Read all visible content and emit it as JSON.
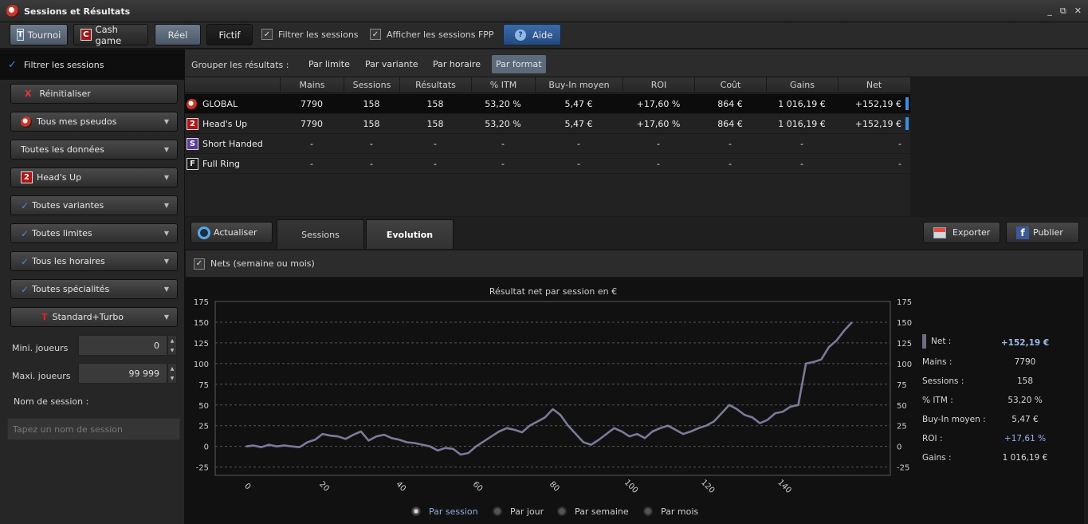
{
  "window": {
    "title": "Sessions et Résultats",
    "controls": [
      "_",
      "⧉",
      "✕"
    ]
  },
  "topbar": {
    "tournoi": {
      "badge": "T",
      "label": "Tournoi"
    },
    "cash": {
      "badge": "C",
      "label": "Cash game"
    },
    "reel": "Réel",
    "fictif": "Fictif",
    "filtrer": "Filtrer les sessions",
    "fpp": "Afficher les sessions FPP",
    "aide": "Aide"
  },
  "sidebar": {
    "header": "Filtrer les sessions",
    "reset": "Réinitialiser",
    "pseudos": "Tous mes pseudos",
    "donnees": "Toutes les données",
    "headsup": {
      "badge": "2",
      "label": "Head's Up"
    },
    "variantes": "Toutes variantes",
    "limites": "Toutes limites",
    "horaires": "Tous les horaires",
    "specialites": "Toutes spécialités",
    "speed": "Standard+Turbo",
    "mini_label": "Mini. joueurs",
    "mini_value": "0",
    "maxi_label": "Maxi. joueurs",
    "maxi_value": "99 999",
    "session_label": "Nom de session :",
    "session_placeholder": "Tapez un nom de session"
  },
  "groupbar": {
    "label": "Grouper les résultats :",
    "buttons": [
      "Par limite",
      "Par variante",
      "Par horaire",
      "Par format"
    ],
    "active": "Par format"
  },
  "table": {
    "columns": [
      "Mains",
      "Sessions",
      "Résultats",
      "% ITM",
      "Buy-In moyen",
      "ROI",
      "Coût",
      "Gains",
      "Net"
    ],
    "rows": [
      {
        "badge": "",
        "name": "GLOBAL",
        "cells": [
          "7790",
          "158",
          "158",
          "53,20 %",
          "5,47 €",
          "+17,60 %",
          "864 €",
          "1 016,19 €",
          "+152,19 €"
        ]
      },
      {
        "badge": "2",
        "name": "Head's Up",
        "cells": [
          "7790",
          "158",
          "158",
          "53,20 %",
          "5,47 €",
          "+17,60 %",
          "864 €",
          "1 016,19 €",
          "+152,19 €"
        ]
      },
      {
        "badge": "S",
        "name": "Short Handed",
        "cells": [
          "-",
          "-",
          "-",
          "-",
          "-",
          "-",
          "-",
          "-",
          "-"
        ]
      },
      {
        "badge": "F",
        "name": "Full Ring",
        "cells": [
          "-",
          "-",
          "-",
          "-",
          "-",
          "-",
          "-",
          "-",
          "-"
        ]
      }
    ]
  },
  "tabs": {
    "refresh": "Actualiser",
    "sessions": "Sessions",
    "evolution": "Evolution",
    "export": "Exporter",
    "publish": "Publier"
  },
  "nets_label": "Nets (semaine ou mois)",
  "legend": [
    {
      "k": "Net :",
      "v": "+152,19 €"
    },
    {
      "k": "Mains :",
      "v": "7790"
    },
    {
      "k": "Sessions :",
      "v": "158"
    },
    {
      "k": "% ITM :",
      "v": "53,20 %"
    },
    {
      "k": "Buy-In moyen :",
      "v": "5,47 €"
    },
    {
      "k": "ROI :",
      "v": "+17,61 %"
    },
    {
      "k": "Gains :",
      "v": "1 016,19 €"
    }
  ],
  "radios": {
    "session": "Par session",
    "jour": "Par jour",
    "semaine": "Par semaine",
    "mois": "Par mois"
  },
  "colors": {
    "line": "#7a7a9a",
    "accent": "#3a8ee6",
    "active": "#5c6a79"
  },
  "chart_data": {
    "type": "line",
    "title": "Résultat net par session en €",
    "xlabel": "",
    "ylabel": "",
    "xlim": [
      -8,
      168
    ],
    "ylim": [
      -35,
      175
    ],
    "xticks": [
      0,
      20,
      40,
      60,
      80,
      100,
      120,
      140
    ],
    "yticks": [
      -25,
      0,
      25,
      50,
      75,
      100,
      125,
      150,
      175
    ],
    "grid": true,
    "series": [
      {
        "x": [
          0,
          2,
          4,
          6,
          8,
          10,
          12,
          14,
          16,
          18,
          20,
          22,
          24,
          26,
          28,
          30,
          32,
          34,
          36,
          38,
          40,
          42,
          44,
          46,
          48,
          50,
          52,
          54,
          56,
          58,
          60,
          62,
          64,
          66,
          68,
          70,
          72,
          74,
          76,
          78,
          80,
          82,
          84,
          86,
          88,
          90,
          92,
          94,
          96,
          98,
          100,
          102,
          104,
          106,
          108,
          110,
          112,
          114,
          116,
          118,
          120,
          122,
          124,
          126,
          128,
          130,
          132,
          134,
          136,
          138,
          140,
          142,
          144,
          146,
          148,
          150,
          152,
          154,
          156,
          158
        ],
        "y": [
          0,
          1,
          -1,
          2,
          0,
          1,
          0,
          -1,
          5,
          8,
          15,
          13,
          12,
          9,
          14,
          18,
          7,
          12,
          14,
          10,
          8,
          5,
          4,
          2,
          0,
          -5,
          -2,
          -3,
          -10,
          -8,
          0,
          6,
          12,
          18,
          22,
          20,
          17,
          25,
          30,
          35,
          45,
          38,
          25,
          15,
          5,
          2,
          8,
          15,
          22,
          18,
          12,
          15,
          10,
          18,
          22,
          25,
          20,
          15,
          18,
          22,
          25,
          30,
          40,
          50,
          45,
          38,
          35,
          28,
          32,
          40,
          42,
          48,
          50,
          100,
          102,
          105,
          120,
          128,
          140,
          150
        ]
      }
    ]
  }
}
